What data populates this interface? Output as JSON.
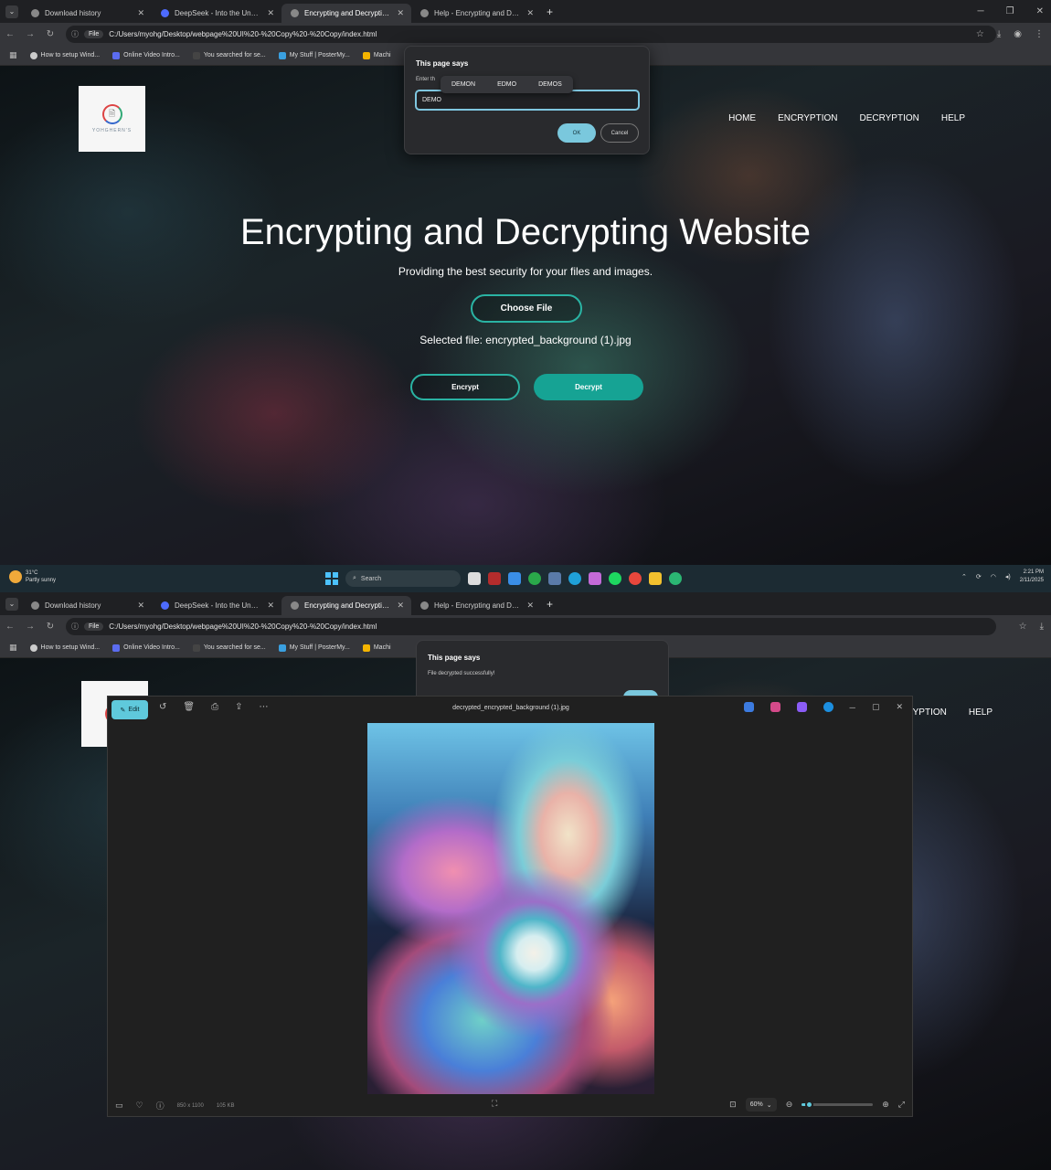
{
  "browser": {
    "tabs": [
      {
        "title": "Download history",
        "active": false
      },
      {
        "title": "DeepSeek - Into the Unknown",
        "active": false
      },
      {
        "title": "Encrypting and Decrypting Wel",
        "active": true
      },
      {
        "title": "Help - Encrypting and Decrypti",
        "active": false
      }
    ],
    "url_chip": "File",
    "url": "C:/Users/myohg/Desktop/webpage%20UI%20-%20Copy%20-%20Copy/index.html",
    "bookmarks": [
      "How to setup Wind...",
      "Online Video Intro...",
      "You searched for se...",
      "My Stuff | PosterMy...",
      "Machi"
    ]
  },
  "site": {
    "logo_text": "YOHGHERN'S",
    "nav": [
      "HOME",
      "ENCRYPTION",
      "DECRYPTION",
      "HELP"
    ],
    "title": "Encrypting and Decrypting Website",
    "subtitle": "Providing the best security for your files and images.",
    "choose_file": "Choose File",
    "selected_file": "Selected file: encrypted_background (1).jpg",
    "encrypt": "Encrypt",
    "decrypt": "Decrypt"
  },
  "prompt_dialog": {
    "title": "This page says",
    "message": "Enter th",
    "input_value": "DEMO",
    "suggestions": [
      "DEMON",
      "EDMO",
      "DEMOS"
    ],
    "ok": "OK",
    "cancel": "Cancel"
  },
  "taskbar": {
    "temperature": "31°C",
    "weather": "Partly sunny",
    "search": "Search",
    "time": "2:21 PM",
    "date": "2/11/2025"
  },
  "screen2": {
    "nav_partial": [
      "YPTION",
      "HELP"
    ],
    "alert": {
      "title": "This page says",
      "message": "File decrypted successfully!"
    },
    "photos": {
      "edit_label": "Edit",
      "filename": "decrypted_encrypted_background (1).jpg",
      "dimensions": "850 x 1100",
      "file_size": "105 KB",
      "zoom": "60%",
      "zoom_level": 0.1
    }
  },
  "colors": {
    "accent_teal": "#16a394",
    "dialog_ok": "#7ac8dd",
    "photos_accent": "#5fc9dc"
  }
}
